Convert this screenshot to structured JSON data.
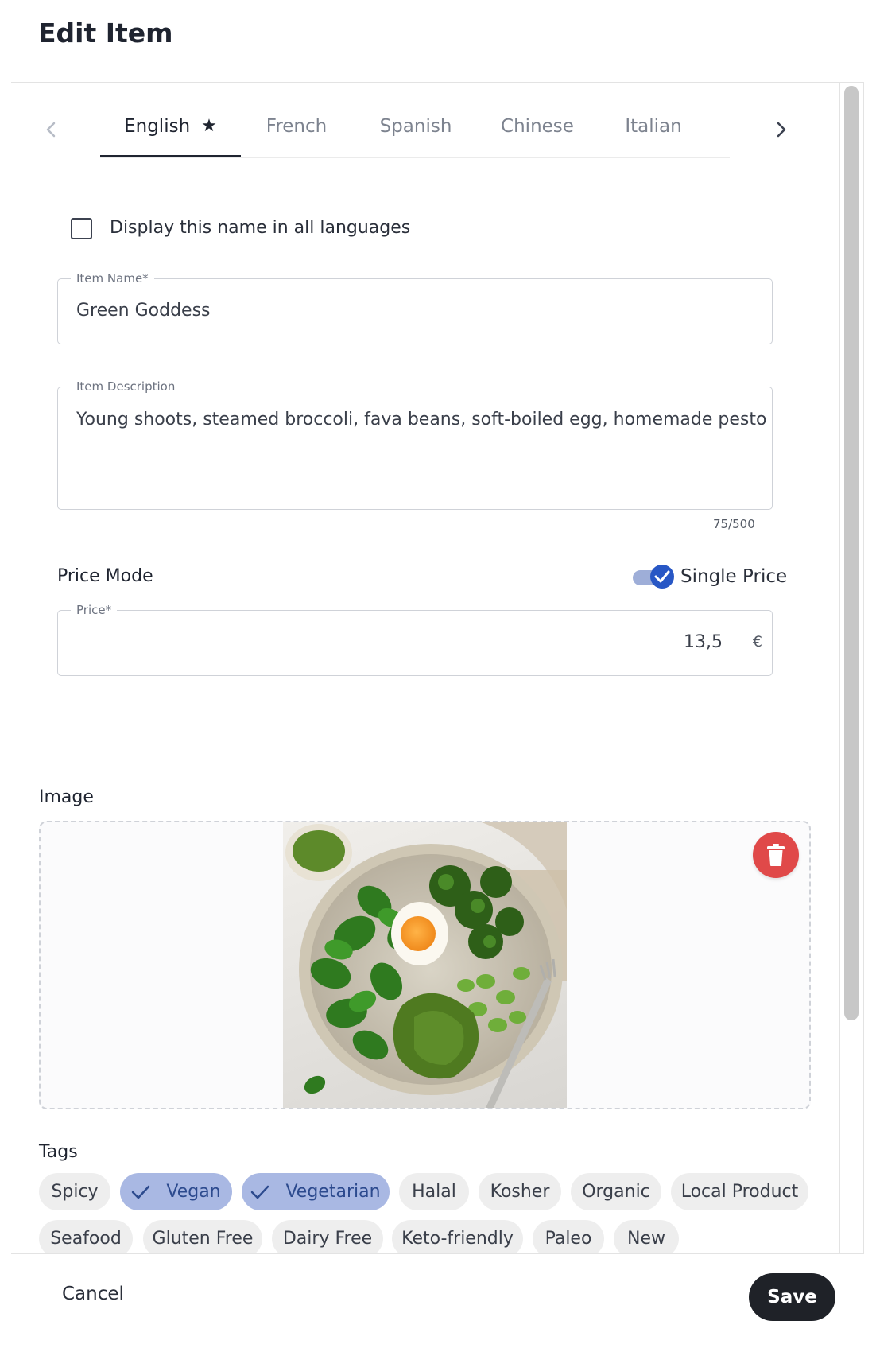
{
  "header": {
    "title": "Edit Item"
  },
  "tabs": {
    "items": [
      {
        "label": "English",
        "marker": "★"
      },
      {
        "label": "French"
      },
      {
        "label": "Spanish"
      },
      {
        "label": "Chinese"
      },
      {
        "label": "Italian"
      }
    ],
    "active_index": 0
  },
  "display_all_languages": {
    "label": "Display this name in all languages",
    "checked": false
  },
  "item_name": {
    "label": "Item Name*",
    "value": "Green Goddess"
  },
  "item_description": {
    "label": "Item Description",
    "value": "Young shoots, steamed broccoli, fava beans, soft-boiled egg, homemade pesto",
    "counter": "75/500"
  },
  "price_mode": {
    "label": "Price Mode",
    "toggle_label": "Single Price",
    "toggle_on": true
  },
  "price": {
    "label": "Price*",
    "value": "13,5",
    "currency": "€"
  },
  "image": {
    "label": "Image"
  },
  "tags": {
    "label": "Tags",
    "items": [
      {
        "label": "Spicy",
        "selected": false
      },
      {
        "label": "Vegan",
        "selected": true
      },
      {
        "label": "Vegetarian",
        "selected": true
      },
      {
        "label": "Halal",
        "selected": false
      },
      {
        "label": "Kosher",
        "selected": false
      },
      {
        "label": "Organic",
        "selected": false
      },
      {
        "label": "Local Product",
        "selected": false
      },
      {
        "label": "Seafood",
        "selected": false
      },
      {
        "label": "Gluten Free",
        "selected": false
      },
      {
        "label": "Dairy Free",
        "selected": false
      },
      {
        "label": "Keto-friendly",
        "selected": false
      },
      {
        "label": "Paleo",
        "selected": false
      },
      {
        "label": "New",
        "selected": false
      }
    ]
  },
  "footer": {
    "cancel_label": "Cancel",
    "save_label": "Save"
  },
  "colors": {
    "accent": "#2857c5",
    "selected_chip": "#a9b8e3",
    "delete": "#e04949",
    "save_button": "#1f2228"
  }
}
